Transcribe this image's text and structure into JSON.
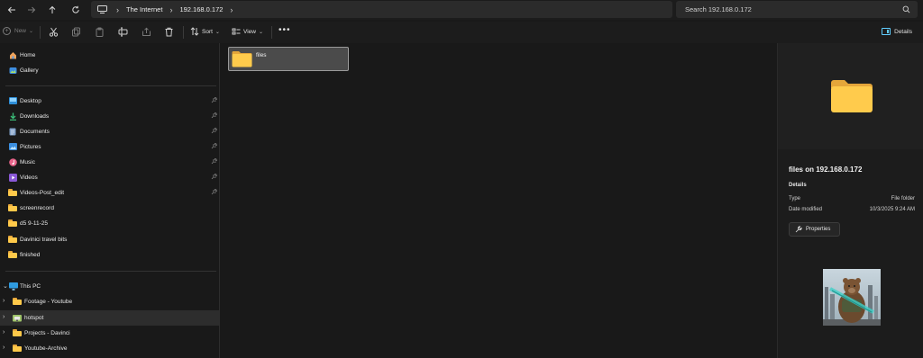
{
  "address": {
    "breadcrumb": [
      "The Internet",
      "192.168.0.172"
    ],
    "search_placeholder": "Search 192.168.0.172"
  },
  "toolbar": {
    "new_label": "New",
    "sort_label": "Sort",
    "view_label": "View",
    "more_label": "•••",
    "details_label": "Details"
  },
  "sidebar": {
    "top": [
      {
        "label": "Home",
        "icon": "home-icon"
      },
      {
        "label": "Gallery",
        "icon": "gallery-icon"
      }
    ],
    "quick": [
      {
        "label": "Desktop",
        "icon": "desktop-icon",
        "pinned": true
      },
      {
        "label": "Downloads",
        "icon": "downloads-icon",
        "pinned": true
      },
      {
        "label": "Documents",
        "icon": "documents-icon",
        "pinned": true
      },
      {
        "label": "Pictures",
        "icon": "pictures-icon",
        "pinned": true
      },
      {
        "label": "Music",
        "icon": "music-icon",
        "pinned": true
      },
      {
        "label": "Videos",
        "icon": "videos-icon",
        "pinned": true
      },
      {
        "label": "Videos-Post_edit",
        "icon": "folder-icon",
        "pinned": true
      },
      {
        "label": "screenrecord",
        "icon": "folder-icon",
        "pinned": false
      },
      {
        "label": "d5 9-11-25",
        "icon": "folder-icon",
        "pinned": false
      },
      {
        "label": "Davinici travel bits",
        "icon": "folder-icon",
        "pinned": false
      },
      {
        "label": "finished",
        "icon": "folder-icon",
        "pinned": false
      }
    ],
    "tree": [
      {
        "label": "This PC",
        "icon": "pc-icon",
        "expanded": true
      },
      {
        "label": "Footage - Youtube",
        "icon": "folder-icon",
        "expanded": false
      },
      {
        "label": "hotspot",
        "icon": "network-folder-icon",
        "expanded": false,
        "selected": true
      },
      {
        "label": "Projects - Davinci",
        "icon": "folder-icon",
        "expanded": false
      },
      {
        "label": "Youtube-Archive",
        "icon": "folder-icon",
        "expanded": false
      }
    ]
  },
  "content": {
    "items": [
      {
        "name": "files",
        "icon": "folder-icon",
        "selected": true
      }
    ]
  },
  "details": {
    "title": "files on 192.168.0.172",
    "section": "Details",
    "rows": [
      {
        "label": "Type",
        "value": "File folder"
      },
      {
        "label": "Date modified",
        "value": "10/3/2025 9:24 AM"
      }
    ],
    "properties_label": "Properties"
  },
  "colors": {
    "accent": "#60cdff",
    "folder": "#ffc94a",
    "background": "#191919"
  }
}
